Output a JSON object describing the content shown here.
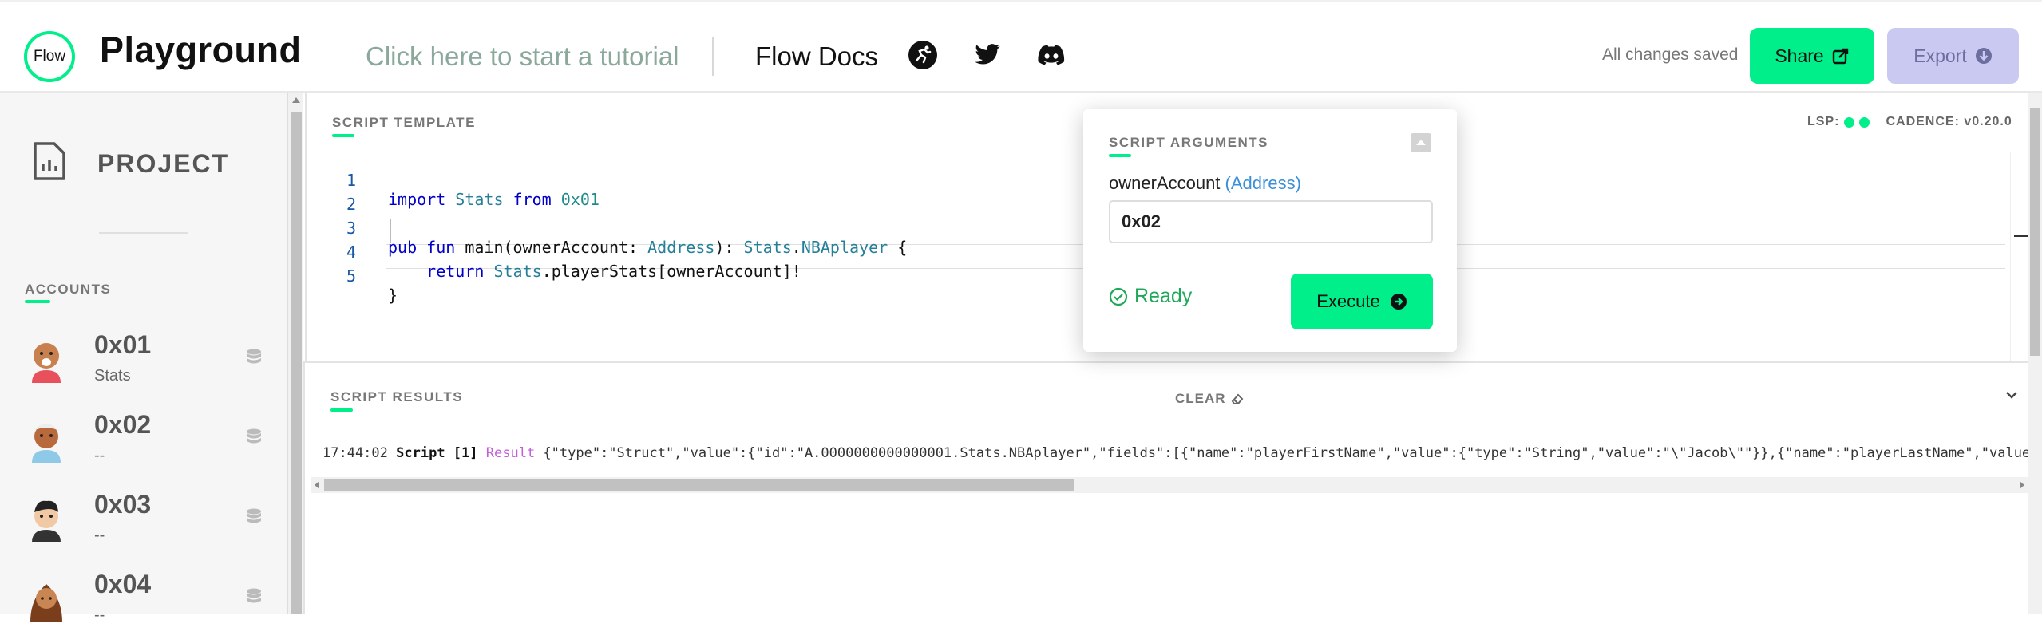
{
  "header": {
    "logo_text": "Flow",
    "title": "Playground",
    "tutorial_link": "Click here to start a tutorial",
    "docs_link": "Flow Docs",
    "social_icons": [
      "flow-runner-icon",
      "twitter-icon",
      "discord-icon"
    ],
    "save_status": "All changes saved",
    "share_label": "Share",
    "export_label": "Export"
  },
  "sidebar": {
    "project_label": "PROJECT",
    "accounts_heading": "ACCOUNTS",
    "accounts": [
      {
        "address": "0x01",
        "subtitle": "Stats"
      },
      {
        "address": "0x02",
        "subtitle": "--"
      },
      {
        "address": "0x03",
        "subtitle": "--"
      },
      {
        "address": "0x04",
        "subtitle": "--"
      }
    ]
  },
  "editor": {
    "section_label": "SCRIPT TEMPLATE",
    "lsp_label": "LSP:",
    "cadence_label": "CADENCE: v0.20.0",
    "line_numbers": [
      "1",
      "2",
      "3",
      "4",
      "5"
    ]
  },
  "args": {
    "section_label": "SCRIPT ARGUMENTS",
    "arg_name": "ownerAccount",
    "arg_type": "(Address)",
    "arg_value": "0x02",
    "status": "Ready",
    "execute_label": "Execute"
  },
  "results": {
    "section_label": "SCRIPT RESULTS",
    "clear_label": "CLEAR",
    "time": "17:44:02",
    "label": "Script [1]",
    "result_word": "Result",
    "payload": "{\"type\":\"Struct\",\"value\":{\"id\":\"A.0000000000000001.Stats.NBAplayer\",\"fields\":[{\"name\":\"playerFirstName\",\"value\":{\"type\":\"String\",\"value\":\"\\\"Jacob\\\"\"}},{\"name\":\"playerLastName\",\"value\":"
  },
  "colors": {
    "accent": "#00ef8b",
    "export_bg": "#c9c9f2",
    "keyword": "#0000c8",
    "type": "#267f99",
    "result_word": "#c35ed8"
  }
}
